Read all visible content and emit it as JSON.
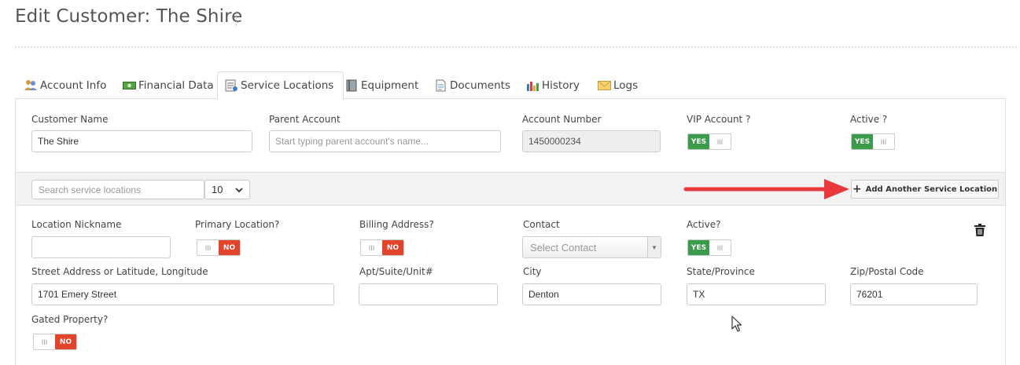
{
  "page": {
    "title": "Edit Customer: The Shire"
  },
  "tabs": [
    {
      "label": "Account Info",
      "icon": "users-icon"
    },
    {
      "label": "Financial Data",
      "icon": "money-icon"
    },
    {
      "label": "Service Locations",
      "icon": "list-icon",
      "active": true
    },
    {
      "label": "Equipment",
      "icon": "book-icon"
    },
    {
      "label": "Documents",
      "icon": "document-icon"
    },
    {
      "label": "History",
      "icon": "bar-chart-icon"
    },
    {
      "label": "Logs",
      "icon": "envelope-icon"
    }
  ],
  "customer": {
    "name_label": "Customer Name",
    "name_value": "The Shire",
    "parent_label": "Parent Account",
    "parent_placeholder": "Start typing parent account's name...",
    "account_number_label": "Account Number",
    "account_number_value": "1450000234",
    "vip_label": "VIP Account ?",
    "vip_toggle": "YES",
    "active_label": "Active ?",
    "active_toggle": "YES"
  },
  "toolbar": {
    "search_placeholder": "Search service locations",
    "page_size": "10",
    "add_button_label": "Add Another Service Location"
  },
  "location": {
    "nickname_label": "Location Nickname",
    "nickname_value": "",
    "primary_label": "Primary Location?",
    "primary_toggle": "NO",
    "billing_label": "Billing Address?",
    "billing_toggle": "NO",
    "contact_label": "Contact",
    "contact_placeholder": "Select Contact",
    "active_label": "Active?",
    "active_toggle": "YES",
    "street_label": "Street Address or Latitude, Longitude",
    "street_value": "1701 Emery Street",
    "apt_label": "Apt/Suite/Unit#",
    "apt_value": "",
    "city_label": "City",
    "city_value": "Denton",
    "state_label": "State/Province",
    "state_value": "TX",
    "zip_label": "Zip/Postal Code",
    "zip_value": "76201",
    "gated_label": "Gated Property?",
    "gated_toggle": "NO"
  },
  "toggle_grip": "III",
  "colors": {
    "yes": "#3a9b4a",
    "no": "#e2432b",
    "arrow": "#e8383b"
  }
}
